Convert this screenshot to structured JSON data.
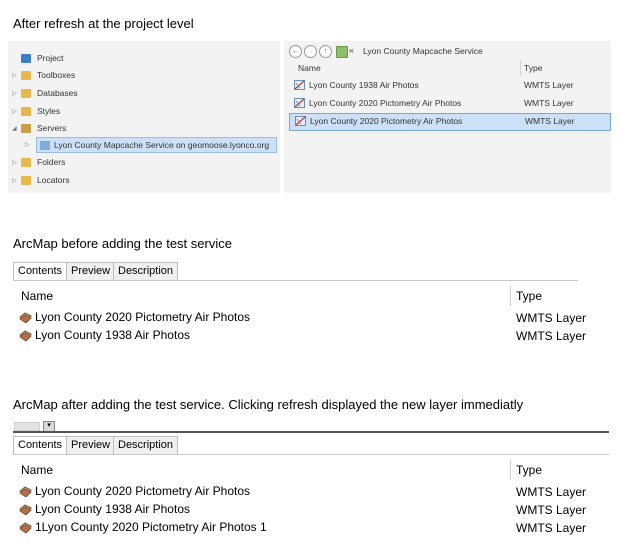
{
  "headings": {
    "pro": "After refresh at the project level",
    "before": "ArcMap before adding the test service",
    "after": "ArcMap after adding the test service.  Clicking refresh displayed the new layer immediatly"
  },
  "catalog": {
    "items": [
      {
        "label": "Project",
        "icon": "project-icon"
      },
      {
        "label": "Toolboxes",
        "icon": "toolbox-icon"
      },
      {
        "label": "Databases",
        "icon": "database-icon"
      },
      {
        "label": "Styles",
        "icon": "styles-icon"
      },
      {
        "label": "Servers",
        "icon": "server-icon"
      },
      {
        "label": "Lyon County Mapcache Service on geomoose.lyonco.org",
        "icon": "wmts-service-icon"
      },
      {
        "label": "Folders",
        "icon": "folder-icon"
      },
      {
        "label": "Locators",
        "icon": "locator-icon"
      }
    ]
  },
  "pro_contents": {
    "location_prefix": "«",
    "location": "Lyon County Mapcache Service",
    "col_name": "Name",
    "col_type": "Type",
    "rows": [
      {
        "name": "Lyon County 1938 Air Photos",
        "type": "WMTS Layer"
      },
      {
        "name": "Lyon County 2020 Pictometry Air Photos",
        "type": "WMTS Layer"
      },
      {
        "name": "Lyon County 2020 Pictometry Air Photos",
        "type": "WMTS Layer"
      }
    ]
  },
  "tabs": {
    "contents": "Contents",
    "preview": "Preview",
    "description": "Description"
  },
  "arcmap_before": {
    "col_name": "Name",
    "col_type": "Type",
    "rows": [
      {
        "name": "Lyon County 2020 Pictometry Air Photos",
        "type": "WMTS Layer"
      },
      {
        "name": "Lyon County 1938 Air Photos",
        "type": "WMTS Layer"
      }
    ]
  },
  "arcmap_after": {
    "col_name": "Name",
    "col_type": "Type",
    "rows": [
      {
        "name": "Lyon County 2020 Pictometry Air Photos",
        "type": "WMTS Layer"
      },
      {
        "name": "Lyon County 1938 Air Photos",
        "type": "WMTS Layer"
      },
      {
        "name": "1Lyon County 2020 Pictometry Air Photos 1",
        "type": "WMTS Layer"
      }
    ]
  },
  "colors": {
    "selection": "#cce1f7",
    "pane_bg": "#f3f3f3",
    "folder": "#e9b84a"
  }
}
